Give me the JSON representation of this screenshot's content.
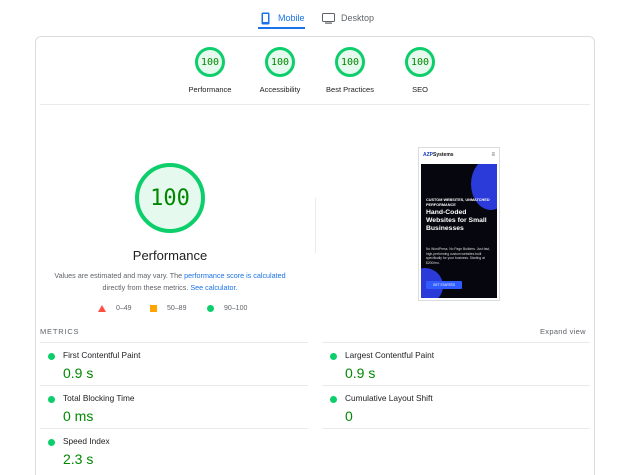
{
  "tabs": [
    {
      "label": "Mobile",
      "icon": "smartphone-icon",
      "active": true
    },
    {
      "label": "Desktop",
      "icon": "monitor-icon",
      "active": false
    }
  ],
  "colors": {
    "accent": "#1a73e8",
    "pass": "#0cce6b",
    "pass_text": "#008800",
    "average": "#ffa400",
    "fail": "#ff4e42"
  },
  "categories": [
    {
      "score": "100",
      "label": "Performance"
    },
    {
      "score": "100",
      "label": "Accessibility"
    },
    {
      "score": "100",
      "label": "Best Practices"
    },
    {
      "score": "100",
      "label": "SEO"
    }
  ],
  "performance": {
    "score": "100",
    "title": "Performance",
    "desc_prefix": "Values are estimated and may vary. The ",
    "desc_link1": "performance score is calculated",
    "desc_middle": " directly from these metrics. ",
    "desc_link2": "See calculator."
  },
  "legend": [
    {
      "range": "0–49",
      "shape": "triangle"
    },
    {
      "range": "50–89",
      "shape": "square"
    },
    {
      "range": "90–100",
      "shape": "circle"
    }
  ],
  "screenshot": {
    "logo_a": "AZP",
    "logo_b": "Systems",
    "tagline": "CUSTOM WEBSITES, UNMATCHED PERFORMANCE",
    "headline": "Hand-Coded Websites for Small Businesses",
    "body": "No WordPress. No Page Builders. Just fast, high-performing custom websites built specifically for your business. Starting at $200/mo.",
    "cta": "GET STARTED"
  },
  "metrics": {
    "heading": "METRICS",
    "expand_label": "Expand view",
    "items": [
      {
        "name": "First Contentful Paint",
        "value": "0.9 s"
      },
      {
        "name": "Largest Contentful Paint",
        "value": "0.9 s"
      },
      {
        "name": "Total Blocking Time",
        "value": "0 ms"
      },
      {
        "name": "Cumulative Layout Shift",
        "value": "0"
      },
      {
        "name": "Speed Index",
        "value": "2.3 s"
      }
    ]
  }
}
